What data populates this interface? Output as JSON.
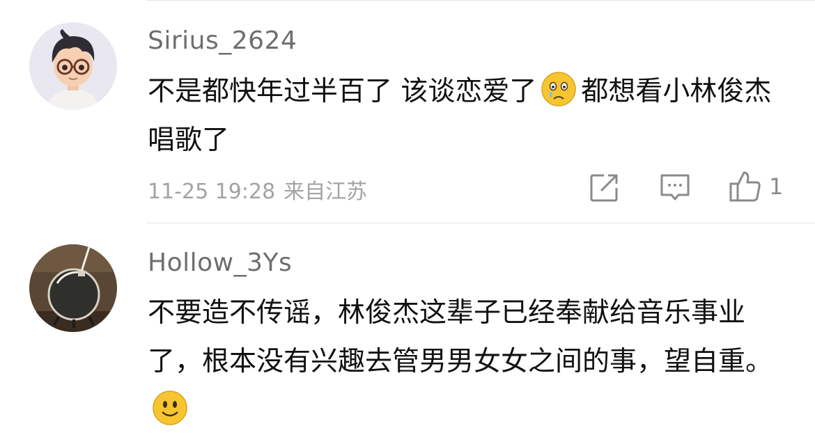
{
  "comments": [
    {
      "username": "Sirius_2624",
      "text_before_emoji": "不是都快年过半百了 该谈恋爱了",
      "emoji": "crying-face-emoji",
      "text_after_emoji": "都想看小林俊杰唱歌了",
      "timestamp": "11-25 19:28",
      "location": "来自江苏",
      "like_count": "1"
    },
    {
      "username": "Hollow_3Ys",
      "text_before_emoji": "不要造不传谣，林俊杰这辈子已经奉献给音乐事业了，根本没有兴趣去管男男女女之间的事，望自重。",
      "emoji": "smiley-face-emoji"
    }
  ],
  "colors": {
    "username": "#6e6e6e",
    "text": "#111111",
    "meta": "#a3a3a3",
    "icon": "#8a8a8a",
    "emoji_yellow": "#f7c531"
  }
}
